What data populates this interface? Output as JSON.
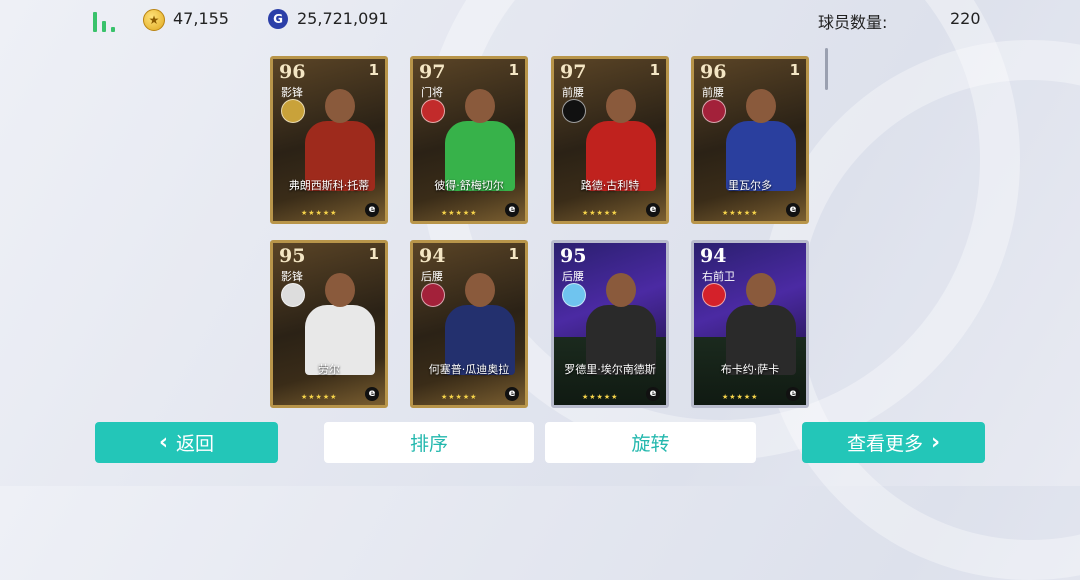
{
  "topbar": {
    "coins": "47,155",
    "gp": "25,721,091",
    "gp_icon_letter": "G",
    "player_count_label": "球员数量:",
    "player_count": "220"
  },
  "cards": [
    {
      "rating": "96",
      "level": "1",
      "position": "影锋",
      "name": "弗朗西斯科·托蒂",
      "style": "legend",
      "kit": "#9e2a1c",
      "club": "#c9a23a"
    },
    {
      "rating": "97",
      "level": "1",
      "position": "门将",
      "name": "彼得·舒梅切尔",
      "style": "legend",
      "kit": "#37b24a",
      "club": "#c22b2b"
    },
    {
      "rating": "97",
      "level": "1",
      "position": "前腰",
      "name": "路德·古利特",
      "style": "legend",
      "kit": "#c0221e",
      "club": "#111111"
    },
    {
      "rating": "96",
      "level": "1",
      "position": "前腰",
      "name": "里瓦尔多",
      "style": "legend",
      "kit": "#2a3f9e",
      "club": "#a3213a"
    },
    {
      "rating": "95",
      "level": "1",
      "position": "影锋",
      "name": "劳尔",
      "style": "legend",
      "kit": "#e8e8e8",
      "club": "#dddddd"
    },
    {
      "rating": "94",
      "level": "1",
      "position": "后腰",
      "name": "何塞普·瓜迪奥拉",
      "style": "legend",
      "kit": "#23306e",
      "club": "#a3213a"
    },
    {
      "rating": "95",
      "level": "",
      "position": "后腰",
      "name": "罗德里·埃尔南德斯",
      "style": "purple",
      "kit": "#2a2a2a",
      "club": "#6fc4ef"
    },
    {
      "rating": "94",
      "level": "",
      "position": "右前卫",
      "name": "布卡约·萨卡",
      "style": "purple",
      "kit": "#2a2a2a",
      "club": "#d4212a"
    }
  ],
  "stars": "★★★★★",
  "e_logo": "e",
  "buttons": {
    "back": "返回",
    "sort": "排序",
    "rotate": "旋转",
    "more": "查看更多"
  },
  "colors": {
    "accent": "#23c6b8",
    "signal": "#39c26b"
  }
}
